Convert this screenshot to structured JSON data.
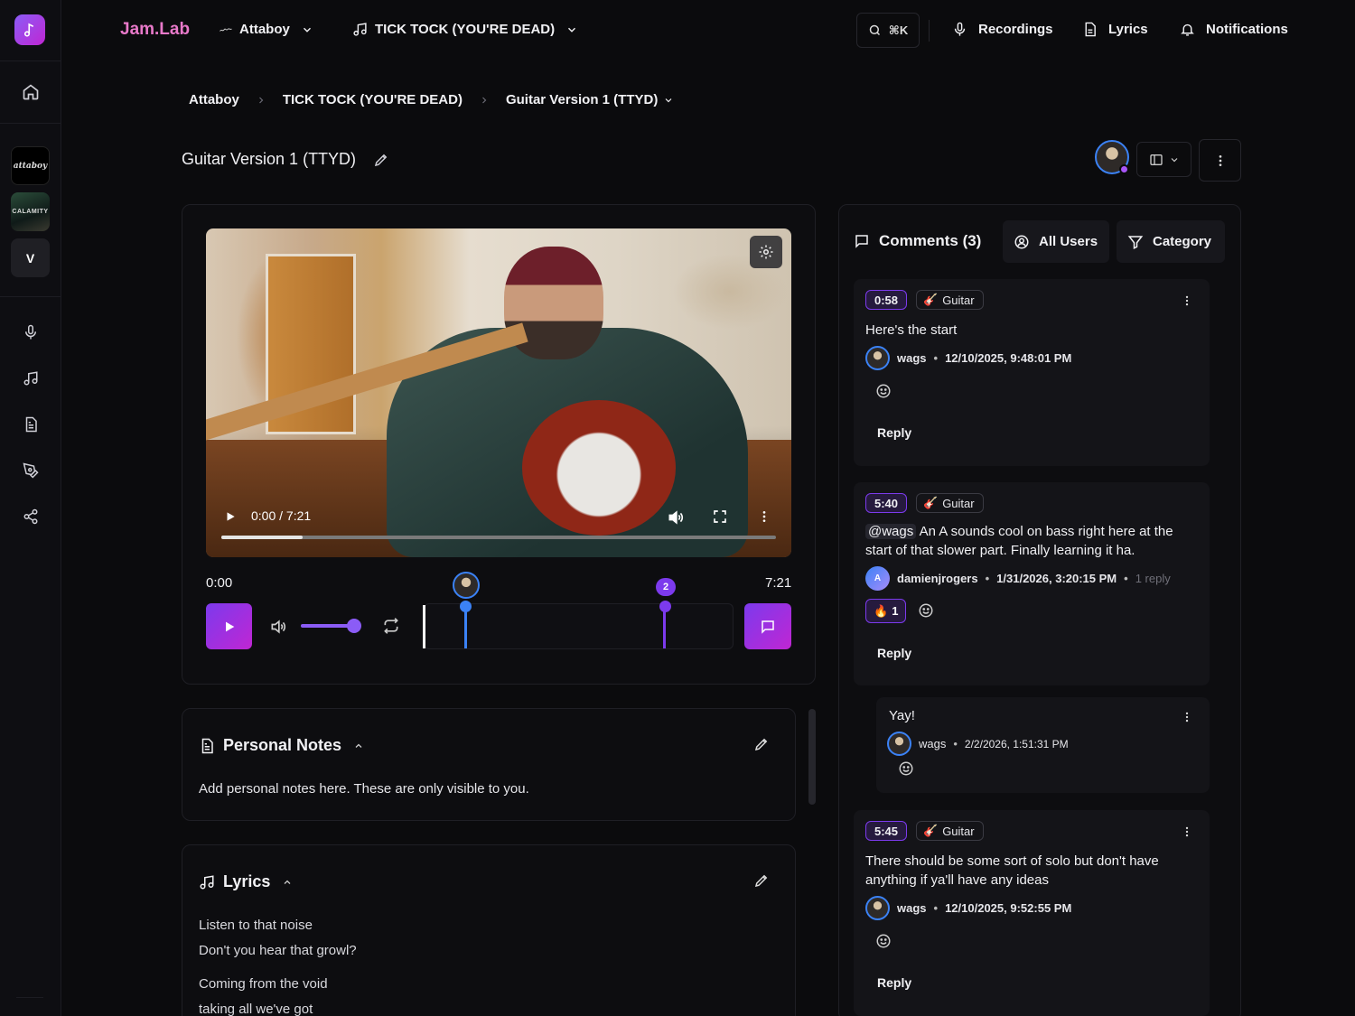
{
  "app": {
    "brand": "Jam.Lab"
  },
  "topbar": {
    "project_label": "Attaboy",
    "song_label": "TICK TOCK (YOU'RE DEAD)",
    "search_shortcut": "⌘K",
    "recordings": "Recordings",
    "lyrics": "Lyrics",
    "notifications": "Notifications"
  },
  "sidebar": {
    "projects": [
      {
        "label": "attaboy"
      },
      {
        "label": "CALAMITY"
      },
      {
        "label": "V"
      }
    ],
    "nav": [
      "home-icon",
      "mic-icon",
      "music-note-icon",
      "document-icon",
      "pen-tool-icon",
      "share-icon"
    ]
  },
  "breadcrumb": {
    "items": [
      "Attaboy",
      "TICK TOCK (YOU'RE DEAD)",
      "Guitar Version 1 (TTYD)"
    ]
  },
  "page": {
    "title": "Guitar Version 1 (TTYD)"
  },
  "player": {
    "video_time": "0:00 / 7:21",
    "time_start": "0:00",
    "time_end": "7:21",
    "volume": 0.9,
    "marker_number": "2",
    "marker_positions": [
      0.14,
      0.78
    ],
    "accent": "#7c3aed",
    "accent2": "#c026d3"
  },
  "notes": {
    "title": "Personal Notes",
    "text": "Add personal notes here. These are only visible to you."
  },
  "lyrics": {
    "title": "Lyrics",
    "lines": [
      "Listen to that noise",
      "Don't you hear that growl?",
      "Coming from the void",
      "taking all we've got"
    ]
  },
  "comments": {
    "title": "Comments (3)",
    "filter_users": "All Users",
    "filter_category": "Category",
    "reply_label": "Reply",
    "items": [
      {
        "time": "0:58",
        "category": "Guitar",
        "text": "Here's the start",
        "author": "wags",
        "date": "12/10/2025, 9:48:01 PM"
      },
      {
        "time": "5:40",
        "category": "Guitar",
        "mention": "@wags",
        "text": "An A sounds cool on bass right here at the start of that slower part. Finally learning it ha.",
        "author": "damienjrogers",
        "author_initial": "A",
        "date": "1/31/2026, 3:20:15 PM",
        "reply_count": "1 reply",
        "reaction_emoji": "🔥",
        "reaction_count": "1"
      },
      {
        "time": "5:45",
        "category": "Guitar",
        "text": "There should be some sort of solo but don't have anything if ya'll have any ideas",
        "author": "wags",
        "date": "12/10/2025, 9:52:55 PM"
      }
    ],
    "reply": {
      "text": "Yay!",
      "author": "wags",
      "date": "2/2/2026, 1:51:31 PM"
    }
  }
}
